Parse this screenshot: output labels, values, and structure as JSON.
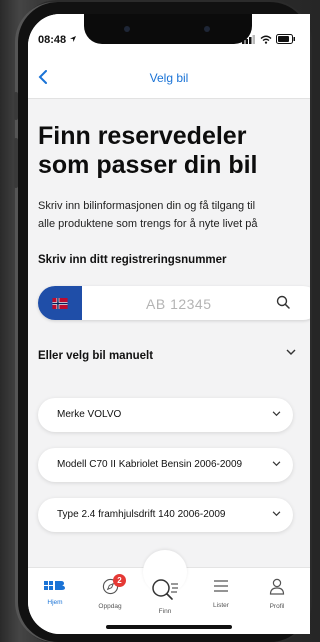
{
  "status_bar": {
    "time": "08:48"
  },
  "nav": {
    "title": "Velg bil"
  },
  "headline": {
    "line1": "Finn reservedeler",
    "line2": "som passer din bil"
  },
  "description": {
    "line1": "Skriv inn bilinformasjonen din og få tilgang til",
    "line2": "alle produktene som trengs for å nyte livet på"
  },
  "registration": {
    "label": "Skriv inn ditt registreringsnummer",
    "placeholder": "AB 12345",
    "country": "Norway"
  },
  "manual": {
    "label": "Eller velg bil manuelt",
    "selects": [
      {
        "text": "Merke  VOLVO"
      },
      {
        "text": "Modell  C70 II Kabriolet Bensin  2006-2009"
      },
      {
        "text": "Type  2.4 framhjulsdrift 140 2006-2009"
      }
    ]
  },
  "tabs": [
    {
      "label": "Hjem",
      "icon": "home-logo-icon",
      "active": true
    },
    {
      "label": "Oppdag",
      "icon": "compass-icon",
      "badge": "2"
    },
    {
      "label": "Finn",
      "icon": "search-list-icon"
    },
    {
      "label": "Lister",
      "icon": "list-icon"
    },
    {
      "label": "Profil",
      "icon": "person-icon"
    }
  ],
  "colors": {
    "accent": "#1a73d6",
    "flag_blue": "#1f4ea8",
    "badge_red": "#e53935",
    "background": "#f3f3f4"
  }
}
